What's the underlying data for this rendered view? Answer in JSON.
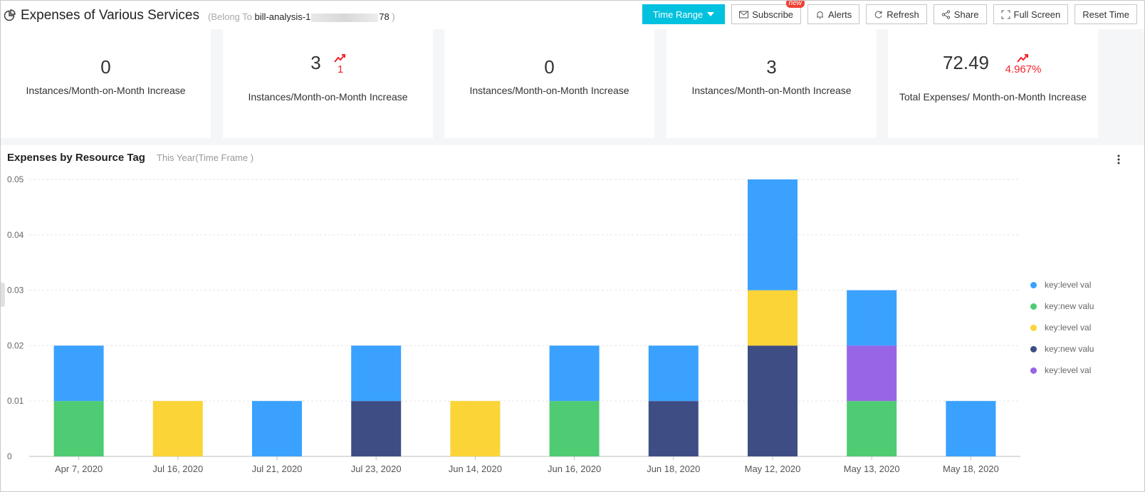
{
  "header": {
    "title": "Expenses of Various Services",
    "belong_prefix": "(Belong To",
    "project_start": "bill-analysis-1",
    "project_end": "78",
    "belong_suffix": ")"
  },
  "toolbar": {
    "time_range": "Time Range",
    "subscribe": "Subscribe",
    "subscribe_badge": "new",
    "alerts": "Alerts",
    "refresh": "Refresh",
    "share": "Share",
    "full_screen": "Full Screen",
    "reset_time": "Reset Time"
  },
  "cards": [
    {
      "value": "0",
      "trend": "",
      "label": "Instances/Month-on-Month Increase"
    },
    {
      "value": "3",
      "trend": "1",
      "label": "Instances/Month-on-Month Increase"
    },
    {
      "value": "0",
      "trend": "",
      "label": "Instances/Month-on-Month Increase"
    },
    {
      "value": "3",
      "trend": "",
      "label": "Instances/Month-on-Month Increase"
    },
    {
      "value": "72.49",
      "trend": "4.967%",
      "label": "Total Expenses/ Month-on-Month Increase"
    }
  ],
  "panel": {
    "title": "Expenses by Resource Tag",
    "subtitle": "This Year(Time Frame )"
  },
  "colors": {
    "accent": "#00c1de",
    "trend_up": "#f5222d"
  },
  "chart_data": {
    "type": "bar",
    "stacked": true,
    "categories": [
      "Apr 7, 2020",
      "Jul 16, 2020",
      "Jul 21, 2020",
      "Jul 23, 2020",
      "Jun 14, 2020",
      "Jun 16, 2020",
      "Jun 18, 2020",
      "May 12, 2020",
      "May 13, 2020",
      "May 18, 2020"
    ],
    "ylim": [
      0,
      0.05
    ],
    "yticks": [
      "0",
      "0.01",
      "0.02",
      "0.03",
      "0.04",
      "0.05"
    ],
    "grid": true,
    "legend_position": "right",
    "series": [
      {
        "name": "key:new valu",
        "color": "#3f4d85",
        "values": [
          0,
          0,
          0,
          0.01,
          0,
          0,
          0.01,
          0.02,
          0,
          0
        ]
      },
      {
        "name": "key:new valu",
        "color": "#4ecb73",
        "values": [
          0.01,
          0,
          0,
          0,
          0,
          0.01,
          0,
          0,
          0.01,
          0
        ]
      },
      {
        "name": "key:level val",
        "color": "#9765e5",
        "values": [
          0,
          0,
          0,
          0,
          0,
          0,
          0,
          0,
          0.01,
          0
        ]
      },
      {
        "name": "key:level val",
        "color": "#fbd437",
        "values": [
          0,
          0.01,
          0,
          0,
          0.01,
          0,
          0,
          0.01,
          0,
          0
        ]
      },
      {
        "name": "key:level val",
        "color": "#3aa1ff",
        "values": [
          0.01,
          0,
          0.01,
          0.01,
          0,
          0.01,
          0.01,
          0.02,
          0.01,
          0.01
        ]
      }
    ],
    "legend": [
      {
        "name": "key:level val",
        "color": "#3aa1ff"
      },
      {
        "name": "key:new valu",
        "color": "#4ecb73"
      },
      {
        "name": "key:level val",
        "color": "#fbd437"
      },
      {
        "name": "key:new valu",
        "color": "#3f4d85"
      },
      {
        "name": "key:level val",
        "color": "#9765e5"
      }
    ]
  }
}
